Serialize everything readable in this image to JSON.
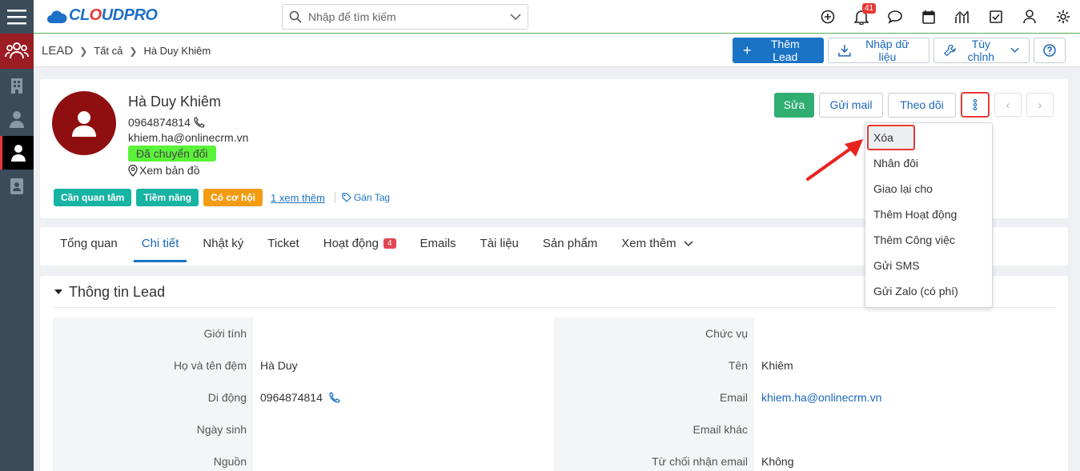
{
  "app": {
    "logo_text_a": "CL",
    "logo_text_b": "UDPRO"
  },
  "search": {
    "placeholder": "Nhập để tìm kiếm"
  },
  "top_icons": {
    "notification_count": "41"
  },
  "breadcrumb": {
    "root": "LEAD",
    "level1": "Tất cả",
    "current": "Hà Duy Khiêm"
  },
  "crumb_actions": {
    "add": "Thêm Lead",
    "import": "Nhập dữ liệu",
    "customize": "Tùy chỉnh"
  },
  "lead": {
    "name": "Hà Duy Khiêm",
    "phone": "0964874814",
    "email": "khiem.ha@onlinecrm.vn",
    "status": "Đã chuyển đổi",
    "map_link": "Xem bản đồ",
    "tags": [
      "Cần quan tâm",
      "Tiềm năng",
      "Có cơ hội"
    ],
    "more_tags": "1 xem thêm",
    "add_tag": "Gán Tag"
  },
  "header_actions": {
    "edit": "Sửa",
    "send_mail": "Gửi mail",
    "follow": "Theo dõi"
  },
  "tabs": [
    {
      "label": "Tổng quan"
    },
    {
      "label": "Chi tiết",
      "active": true
    },
    {
      "label": "Nhật ký"
    },
    {
      "label": "Ticket"
    },
    {
      "label": "Hoạt động",
      "count": "4"
    },
    {
      "label": "Emails"
    },
    {
      "label": "Tài liệu"
    },
    {
      "label": "Sản phẩm"
    },
    {
      "label": "Xem thêm"
    }
  ],
  "section": {
    "title": "Thông tin Lead"
  },
  "fields_left": [
    {
      "label": "Giới tính",
      "value": ""
    },
    {
      "label": "Họ và tên đệm",
      "value": "Hà Duy"
    },
    {
      "label": "Di động",
      "value": "0964874814"
    },
    {
      "label": "Ngày sinh",
      "value": ""
    },
    {
      "label": "Nguồn",
      "value": ""
    }
  ],
  "fields_right": [
    {
      "label": "Chức vụ",
      "value": ""
    },
    {
      "label": "Tên",
      "value": "Khiêm"
    },
    {
      "label": "Email",
      "value": "khiem.ha@onlinecrm.vn"
    },
    {
      "label": "Email khác",
      "value": ""
    },
    {
      "label": "Từ chối nhận email",
      "value": "Không"
    }
  ],
  "dropdown": [
    "Xóa",
    "Nhân đôi",
    "Giao lại cho",
    "Thêm Hoạt động",
    "Thêm Công việc",
    "Gửi SMS",
    "Gửi Zalo (có phí)"
  ],
  "colors": {
    "accent": "#1a73c4",
    "sidebar": "#3c4b5a",
    "danger": "#e53935",
    "green": "#2fae72"
  }
}
